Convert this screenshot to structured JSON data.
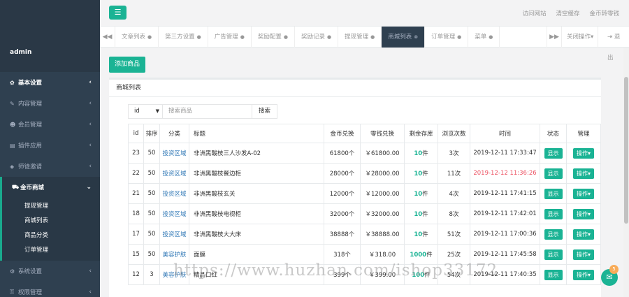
{
  "sidebar": {
    "username": "admin",
    "items": [
      {
        "label": "基本设置",
        "icon": "gear-icon",
        "glyph": "✿"
      },
      {
        "label": "内容管理",
        "icon": "edit-icon",
        "glyph": "✎"
      },
      {
        "label": "会员管理",
        "icon": "user-icon",
        "glyph": "☻"
      },
      {
        "label": "插件应用",
        "icon": "list-icon",
        "glyph": "▤"
      },
      {
        "label": "师徒邀请",
        "icon": "cube-icon",
        "glyph": "◈"
      },
      {
        "label": "金币商城",
        "icon": "cart-icon",
        "glyph": "⛟"
      },
      {
        "label": "系统设置",
        "icon": "cogs-icon",
        "glyph": "⚙"
      },
      {
        "label": "权限管理",
        "icon": "lock-icon",
        "glyph": "⚿"
      }
    ],
    "subitems": [
      "提现管理",
      "商城列表",
      "商品分类",
      "订单管理"
    ]
  },
  "topbar": {
    "menu_glyph": "☰",
    "links": [
      "访问网站",
      "清空缓存",
      "金币转零钱"
    ]
  },
  "tabs": {
    "prev": "◀◀",
    "next": "▶▶",
    "items": [
      "文章列表",
      "第三方设置",
      "广告管理",
      "奖励配置",
      "奖励记录",
      "提现管理",
      "商城列表",
      "订单管理",
      "菜单"
    ],
    "active_index": 6,
    "close_ops": "关闭操作▾",
    "logout": "⇥ 退出"
  },
  "content": {
    "add_button": "添加商品",
    "panel_title": "商城列表",
    "search": {
      "select_value": "id",
      "placeholder": "搜索商品",
      "button": "搜索"
    },
    "table": {
      "headers": [
        "id",
        "排序",
        "分类",
        "标题",
        "金币兑换",
        "零钱兑换",
        "剩余存库",
        "浏览次数",
        "时间",
        "状态",
        "管理"
      ],
      "rows": [
        {
          "id": "23",
          "sort": "50",
          "category": "投资区域",
          "title": "非洲黑酸枝三人沙发A-02",
          "coins": "61800个",
          "cash": "￥61800.00",
          "stock_num": "10",
          "stock_unit": "件",
          "views": "3次",
          "time": "2019-12-11 17:33:47",
          "time_red": false,
          "status": "显示",
          "ops": "操作▾"
        },
        {
          "id": "22",
          "sort": "50",
          "category": "投资区域",
          "title": "非洲黑酸枝餐边柜",
          "coins": "28000个",
          "cash": "￥28000.00",
          "stock_num": "10",
          "stock_unit": "件",
          "views": "11次",
          "time": "2019-12-12 11:36:26",
          "time_red": true,
          "status": "显示",
          "ops": "操作▾"
        },
        {
          "id": "21",
          "sort": "50",
          "category": "投资区域",
          "title": "非洲黑酸枝玄关",
          "coins": "12000个",
          "cash": "￥12000.00",
          "stock_num": "10",
          "stock_unit": "件",
          "views": "4次",
          "time": "2019-12-11 17:41:15",
          "time_red": false,
          "status": "显示",
          "ops": "操作▾"
        },
        {
          "id": "18",
          "sort": "50",
          "category": "投资区域",
          "title": "非洲黑酸枝电视柜",
          "coins": "32000个",
          "cash": "￥32000.00",
          "stock_num": "10",
          "stock_unit": "件",
          "views": "8次",
          "time": "2019-12-11 17:42:01",
          "time_red": false,
          "status": "显示",
          "ops": "操作▾"
        },
        {
          "id": "17",
          "sort": "50",
          "category": "投资区域",
          "title": "非洲黑酸枝大大床",
          "coins": "38888个",
          "cash": "￥38888.00",
          "stock_num": "10",
          "stock_unit": "件",
          "views": "51次",
          "time": "2019-12-11 17:00:36",
          "time_red": false,
          "status": "显示",
          "ops": "操作▾"
        },
        {
          "id": "15",
          "sort": "50",
          "category": "美容护肤",
          "title": "面膜",
          "coins": "318个",
          "cash": "￥318.00",
          "stock_num": "1000",
          "stock_unit": "件",
          "views": "25次",
          "time": "2019-12-11 17:45:58",
          "time_red": false,
          "status": "显示",
          "ops": "操作▾"
        },
        {
          "id": "12",
          "sort": "3",
          "category": "美容护肤",
          "title": "精品口红",
          "coins": "399个",
          "cash": "￥399.00",
          "stock_num": "100",
          "stock_unit": "件",
          "views": "54次",
          "time": "2019-12-11 17:40:35",
          "time_red": false,
          "status": "显示",
          "ops": "操作▾"
        }
      ]
    }
  },
  "watermark": "https://www.huzhan.com/ishop33172",
  "chat": {
    "badge": "5",
    "glyph": "✉"
  }
}
